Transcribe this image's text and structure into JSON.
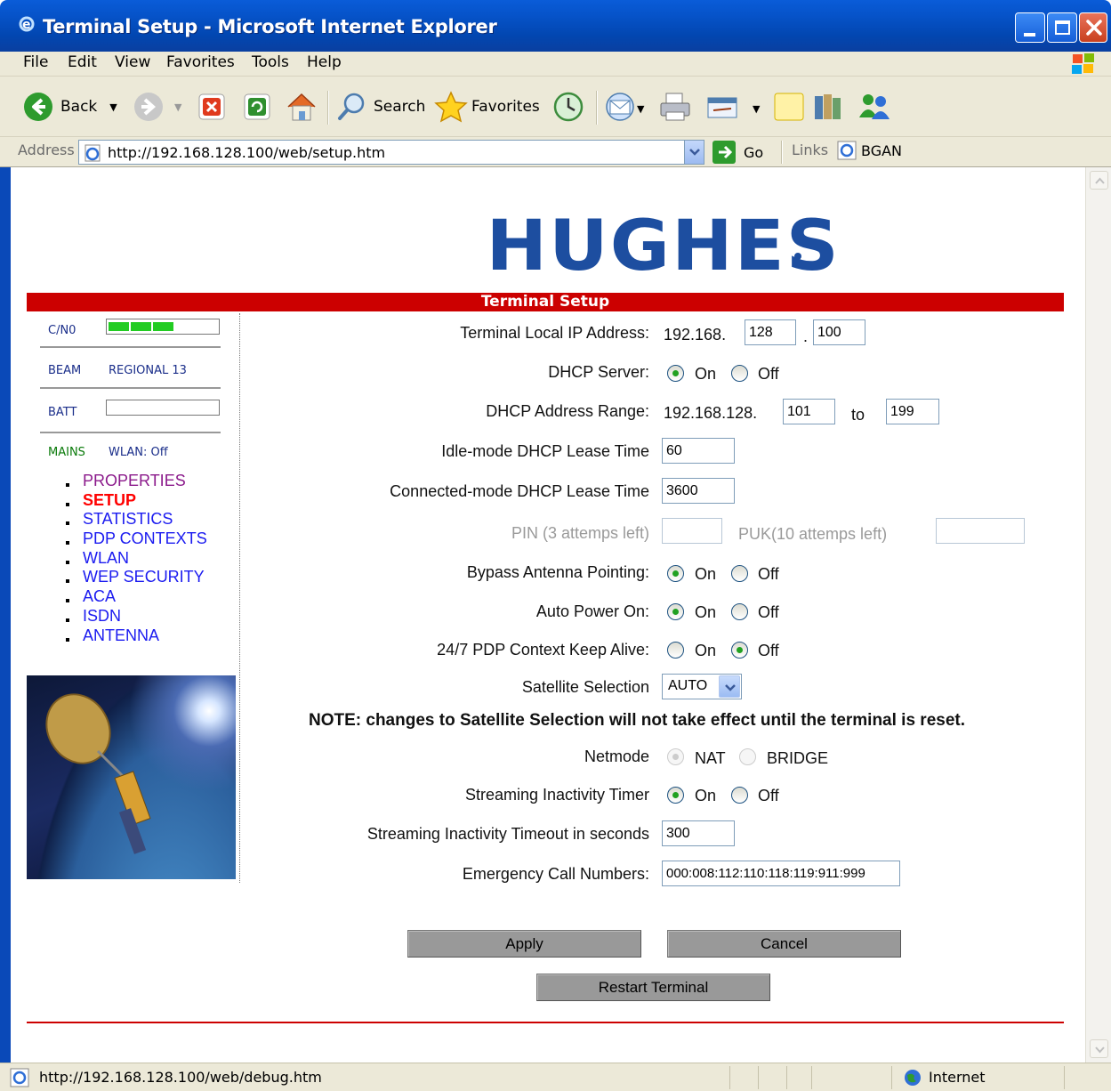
{
  "window": {
    "title": "Terminal Setup - Microsoft Internet Explorer"
  },
  "menu": {
    "items": [
      "File",
      "Edit",
      "View",
      "Favorites",
      "Tools",
      "Help"
    ]
  },
  "toolbar": {
    "back_label": "Back",
    "search_label": "Search",
    "favorites_label": "Favorites"
  },
  "address": {
    "label": "Address",
    "url": "http://192.168.128.100/web/setup.htm",
    "go_label": "Go",
    "links_label": "Links",
    "links_item": "BGAN"
  },
  "status": {
    "url": "http://192.168.128.100/web/debug.htm",
    "zone": "Internet"
  },
  "page": {
    "logo": "HUGHES",
    "section_title": "Terminal Setup",
    "sidebar": {
      "cno_label": "C/N0",
      "cno_level": 3,
      "beam_label": "BEAM",
      "beam_value": "REGIONAL 13",
      "batt_label": "BATT",
      "mains_label": "MAINS",
      "wlan_status": "WLAN: Off",
      "nav": [
        "PROPERTIES",
        "SETUP",
        "STATISTICS",
        "PDP CONTEXTS",
        "WLAN",
        "WEP SECURITY",
        "ACA",
        "ISDN",
        "ANTENNA"
      ],
      "colors": {
        "visited": "#8b1a8b",
        "current": "#ff0000",
        "link": "#1b1bf0"
      }
    },
    "form": {
      "ip_label": "Terminal Local IP Address:",
      "ip_prefix": "192.168.",
      "ip_octet3": "128",
      "ip_dot": ".",
      "ip_octet4": "100",
      "dhcp_server_label": "DHCP Server:",
      "dhcp_range_label": "DHCP Address Range:",
      "dhcp_range_prefix": "192.168.128.",
      "dhcp_range_start": "101",
      "dhcp_range_to": "to",
      "dhcp_range_end": "199",
      "idle_lease_label": "Idle-mode DHCP Lease Time",
      "idle_lease_value": "60",
      "connected_lease_label": "Connected-mode DHCP Lease Time",
      "connected_lease_value": "3600",
      "pin_label": "PIN (3 attemps left)",
      "puk_label": "PUK(10 attemps left)",
      "bypass_label": "Bypass Antenna Pointing:",
      "auto_power_label": "Auto Power On:",
      "keepalive_label": "24/7 PDP Context Keep Alive:",
      "satellite_label": "Satellite Selection",
      "satellite_value": "AUTO",
      "note": "NOTE: changes to Satellite Selection will not take effect until the terminal is reset.",
      "netmode_label": "Netmode",
      "nat_label": "NAT",
      "bridge_label": "BRIDGE",
      "streaming_timer_label": "Streaming Inactivity Timer",
      "streaming_timeout_label": "Streaming Inactivity Timeout in seconds",
      "streaming_timeout_value": "300",
      "emergency_label": "Emergency Call Numbers:",
      "emergency_value": "000:008:112:110:118:119:911:999",
      "on_label": "On",
      "off_label": "Off",
      "apply_label": "Apply",
      "cancel_label": "Cancel",
      "restart_label": "Restart Terminal"
    }
  },
  "colors": {
    "title_blue": "#0653c9",
    "chrome": "#ece9d8",
    "red_accent": "#cc0000",
    "logo_blue": "#1d4ea0",
    "signal_green": "#22cc22"
  }
}
